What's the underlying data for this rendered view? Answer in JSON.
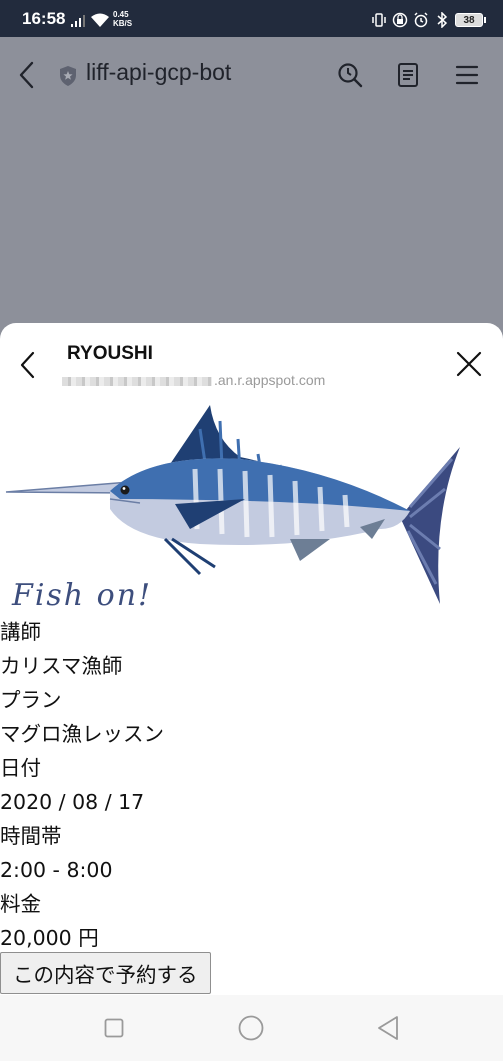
{
  "status_bar": {
    "time": "16:58",
    "net_speed_value": "0.45",
    "net_speed_unit": "KB/S",
    "battery": "38"
  },
  "chat_header": {
    "title": "liff-api-gcp-bot"
  },
  "liff": {
    "title": "RYOUSHI",
    "url_suffix": ".an.r.appspot.com",
    "image_caption": "Fish on!"
  },
  "booking": {
    "instructor_label": "講師",
    "instructor_value": "カリスマ漁師",
    "plan_label": "プラン",
    "plan_value": "マグロ漁レッスン",
    "date_label": "日付",
    "date_value": "2020 / 08 / 17",
    "time_label": "時間帯",
    "time_value": "2:00 - 8:00",
    "price_label": "料金",
    "price_value": "20,000 円",
    "reserve_button": "この内容で予約する"
  },
  "colors": {
    "status_bar": "#222b3d",
    "dim_overlay": "#8d909a",
    "fish_dark": "#1f3f73",
    "fish_mid": "#3f6fb0",
    "fish_belly": "#c3cbe0"
  }
}
